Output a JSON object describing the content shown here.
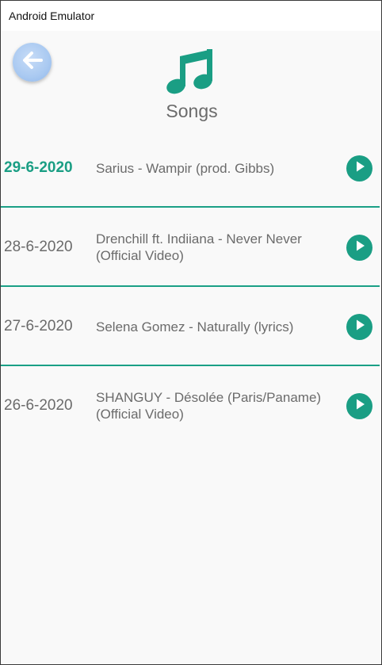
{
  "window": {
    "title": "Android Emulator"
  },
  "header": {
    "title": "Songs",
    "back_icon": "arrow-left-icon",
    "logo_icon": "music-note-icon"
  },
  "colors": {
    "accent": "#1a9e84",
    "back_button": "#a9c9f1",
    "text": "#6b6b6b"
  },
  "songs": [
    {
      "date": "29-6-2020",
      "title": "Sarius - Wampir (prod. Gibbs)",
      "selected": true
    },
    {
      "date": "28-6-2020",
      "title": "Drenchill ft. Indiiana - Never Never (Official Video)",
      "selected": false
    },
    {
      "date": "27-6-2020",
      "title": "Selena Gomez - Naturally (lyrics)",
      "selected": false
    },
    {
      "date": "26-6-2020",
      "title": "SHANGUY - Désolée (Paris/Paname) (Official Video)",
      "selected": false
    }
  ]
}
